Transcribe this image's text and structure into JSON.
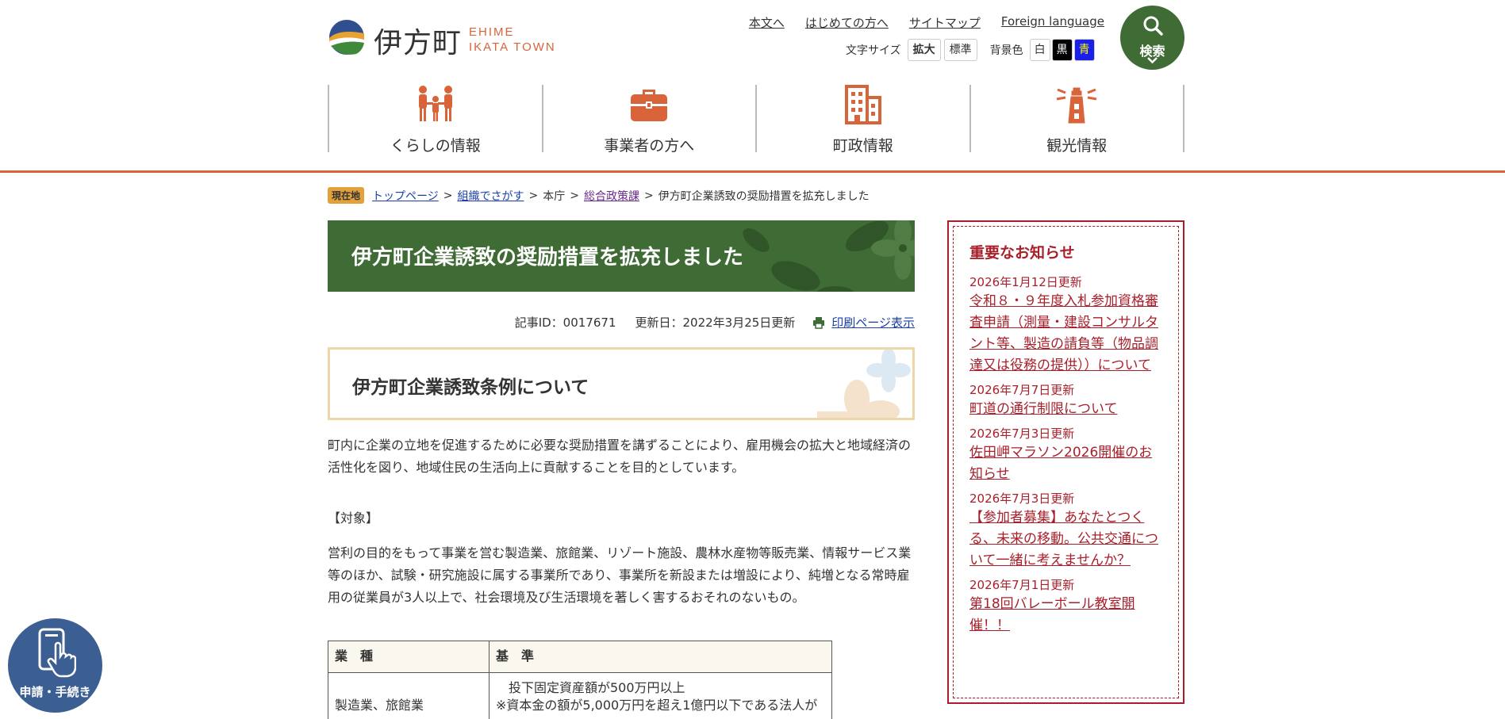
{
  "site": {
    "logo_jp": "伊方町",
    "logo_en_line1": "EHIME",
    "logo_en_line2": "IKATA TOWN"
  },
  "utility_links": [
    "本文へ",
    "はじめての方へ",
    "サイトマップ",
    "Foreign language"
  ],
  "text_size": {
    "label": "文字サイズ",
    "large": "拡大",
    "standard": "標準"
  },
  "bg_color": {
    "label": "背景色",
    "white": "白",
    "black": "黒",
    "blue": "青"
  },
  "search": {
    "label": "検索",
    "icon": "search-icon"
  },
  "global_nav": [
    {
      "label": "くらしの情報",
      "icon": "family-icon"
    },
    {
      "label": "事業者の方へ",
      "icon": "briefcase-icon"
    },
    {
      "label": "町政情報",
      "icon": "building-icon"
    },
    {
      "label": "観光情報",
      "icon": "lighthouse-icon"
    }
  ],
  "breadcrumb": {
    "here_label": "現在地",
    "items": [
      "トップページ",
      "組織でさがす",
      "本庁",
      "総合政策課",
      "伊方町企業誘致の奨励措置を拡充しました"
    ],
    "separator": ">"
  },
  "article": {
    "title": "伊方町企業誘致の奨励措置を拡充しました",
    "id_text": "記事ID：0017671",
    "updated_text": "更新日：2022年3月25日更新",
    "print_label": "印刷ページ表示",
    "section_heading": "伊方町企業誘致条例について",
    "para1": "町内に企業の立地を促進するために必要な奨励措置を講ずることにより、雇用機会の拡大と地域経済の活性化を図り、地域住民の生活向上に貢献することを目的としています。",
    "para2": "【対象】",
    "para3": "営利の目的をもって事業を営む製造業、旅館業、リゾート施設、農林水産物等販売業、情報サービス業等のほか、試験・研究施設に属する事業所であり、事業所を新設または増設により、純増となる常時雇用の従業員が3人以上で、社会環境及び生活環境を著しく害するおそれのないもの。",
    "table": {
      "headers": [
        "業　種",
        "基　準"
      ],
      "row1_col1": "製造業、旅館業",
      "row1_col2_line1": "　投下固定資産額が500万円以上",
      "row1_col2_line2": "※資本金の額が5,000万円を超え1億円以下である法人が"
    }
  },
  "notice": {
    "heading": "重要なお知らせ",
    "items": [
      {
        "date": "2026年1月12日更新",
        "title": "令和８・９年度入札参加資格審査申請（測量・建設コンサルタント等、製造の請負等（物品調達又は役務の提供））について"
      },
      {
        "date": "2026年7月7日更新",
        "title": "町道の通行制限について"
      },
      {
        "date": "2026年7月3日更新",
        "title": "佐田岬マラソン2026開催のお知らせ"
      },
      {
        "date": "2026年7月3日更新",
        "title": "【参加者募集】あなたとつくる、未来の移動。公共交通について一緒に考えませんか？"
      },
      {
        "date": "2026年7月1日更新",
        "title": "第18回バレーボール教室開催！！"
      }
    ]
  },
  "floating": {
    "label": "申請・手続き"
  },
  "colors": {
    "accent": "#d9643a",
    "green": "#3f6b35",
    "notice_red": "#a81f2a",
    "float_blue": "#3b5e93"
  }
}
